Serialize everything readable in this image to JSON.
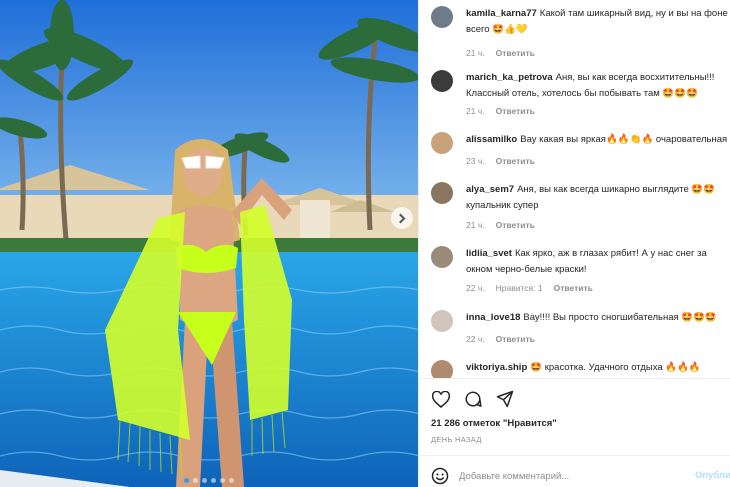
{
  "post": {
    "comments": [
      {
        "user": "kamila_karna77",
        "text": "Какой там шикарный вид, ну и вы на фоне всего 🤩👍💛",
        "time": "21 ч.",
        "likes": "",
        "reply": "Ответить"
      },
      {
        "user": "marich_ka_petrova",
        "text": "Аня, вы как всегда восхитительны!!! Классный отель, хотелось бы побывать там 🤩🤩🤩",
        "time": "21 ч.",
        "likes": "",
        "reply": "Ответить"
      },
      {
        "user": "alissamilko",
        "text": "Вау какая вы яркая🔥🔥👏🔥 очаровательная",
        "time": "23 ч.",
        "likes": "",
        "reply": "Ответить"
      },
      {
        "user": "alya_sem7",
        "text": "Аня, вы как всегда шикарно выглядите 🤩🤩 купальник супер",
        "time": "21 ч.",
        "likes": "",
        "reply": "Ответить"
      },
      {
        "user": "lidiia_svet",
        "text": "Как ярко, аж в глазах рябит! А у нас снег за окном черно-белые краски!",
        "time": "22 ч.",
        "likes": "Нравится: 1",
        "reply": "Ответить"
      },
      {
        "user": "inna_love18",
        "text": "Вау!!!! Вы просто сногшибательная 🤩🤩🤩",
        "time": "22 ч.",
        "likes": "",
        "reply": "Ответить"
      },
      {
        "user": "viktoriya.ship",
        "text": "🤩 красотка. Удачного отдыха 🔥🔥🔥",
        "time": "",
        "likes": "",
        "reply": ""
      }
    ],
    "likes_count": "21 286 отметок \"Нравится\"",
    "date": "ДЕНЬ НАЗАД",
    "add_comment_placeholder": "Добавьте комментарий...",
    "post_label": "Опубликовать"
  },
  "icons": {
    "like": "heart-icon",
    "comment": "comment-icon",
    "share": "share-icon",
    "emoji": "emoji-icon",
    "next": "chevron-right-icon"
  },
  "colors": {
    "link": "#3897f0",
    "post_disabled": "#b2dffc",
    "secondary_text": "#8e8e8e",
    "swimsuit": "#c6ff1a"
  },
  "carousel": {
    "total": 6,
    "active": 0
  }
}
